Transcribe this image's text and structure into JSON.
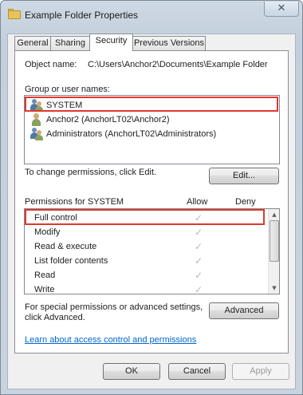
{
  "window": {
    "title": "Example Folder Properties",
    "close_glyph": "✕"
  },
  "tabs": [
    {
      "label": "General"
    },
    {
      "label": "Sharing"
    },
    {
      "label": "Security",
      "active": true
    },
    {
      "label": "Previous Versions"
    }
  ],
  "security": {
    "object_name_label": "Object name:",
    "object_name_value": "C:\\Users\\Anchor2\\Documents\\Example Folder",
    "group_label": "Group or user names:",
    "users": [
      {
        "name": "SYSTEM",
        "icon": "users-group-icon"
      },
      {
        "name": "Anchor2 (AnchorLT02\\Anchor2)",
        "icon": "user-icon"
      },
      {
        "name": "Administrators (AnchorLT02\\Administrators)",
        "icon": "users-group-icon"
      }
    ],
    "change_text": "To change permissions, click Edit.",
    "edit_button": "Edit...",
    "perm_header": "Permissions for SYSTEM",
    "allow_header": "Allow",
    "deny_header": "Deny",
    "permissions": [
      {
        "name": "Full control",
        "allow": "✓",
        "deny": ""
      },
      {
        "name": "Modify",
        "allow": "✓",
        "deny": ""
      },
      {
        "name": "Read & execute",
        "allow": "✓",
        "deny": ""
      },
      {
        "name": "List folder contents",
        "allow": "✓",
        "deny": ""
      },
      {
        "name": "Read",
        "allow": "✓",
        "deny": ""
      },
      {
        "name": "Write",
        "allow": "✓",
        "deny": ""
      }
    ],
    "advanced_text_line1": "For special permissions or advanced settings,",
    "advanced_text_line2": "click Advanced.",
    "advanced_button": "Advanced",
    "learn_link": "Learn about access control and permissions"
  },
  "buttons": {
    "ok": "OK",
    "cancel": "Cancel",
    "apply": "Apply"
  },
  "colors": {
    "highlight": "#e0382d",
    "link": "#0066cc",
    "check": "#b8b8b8"
  }
}
